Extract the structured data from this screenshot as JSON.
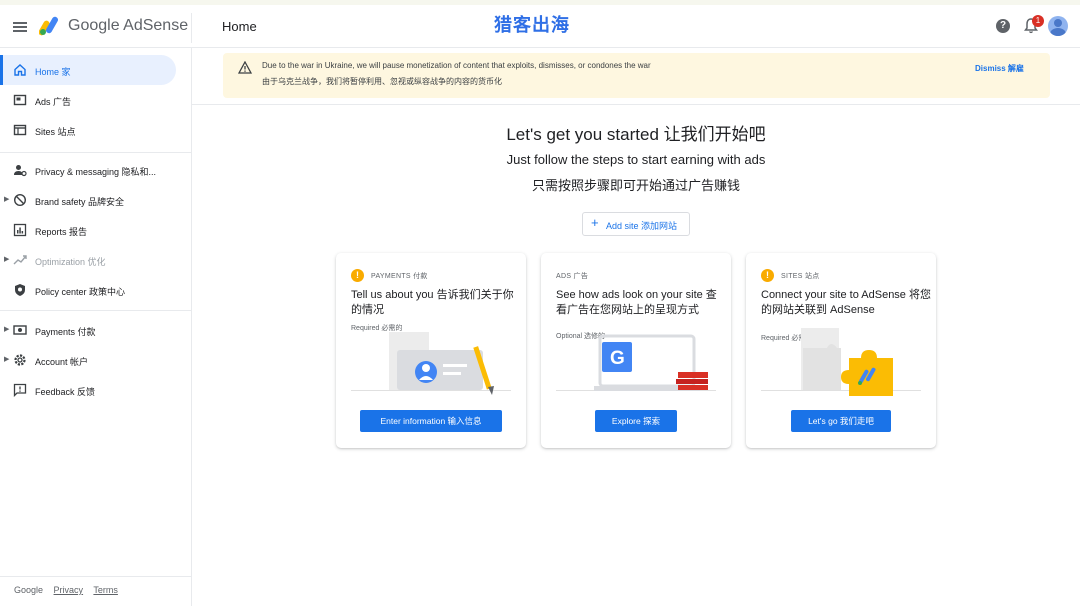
{
  "header": {
    "brand": "Google AdSense",
    "page_title": "Home",
    "watermark": "猎客出海",
    "help_glyph": "?",
    "notification_count": "1"
  },
  "sidebar": {
    "items": [
      {
        "label": "Home 家",
        "icon": "home-icon",
        "active": true
      },
      {
        "label": "Ads 广告",
        "icon": "ads-icon"
      },
      {
        "label": "Sites 站点",
        "icon": "sites-icon"
      },
      {
        "label": "Privacy & messaging 隐私和...",
        "icon": "privacy-icon"
      },
      {
        "label": "Brand safety 品牌安全",
        "icon": "block-icon"
      },
      {
        "label": "Reports 报告",
        "icon": "reports-icon"
      },
      {
        "label": "Optimization 优化",
        "icon": "trending-icon",
        "disabled": true
      },
      {
        "label": "Policy center 政策中心",
        "icon": "shield-icon"
      },
      {
        "label": "Payments 付款",
        "icon": "payments-icon"
      },
      {
        "label": "Account 帐户",
        "icon": "gear-icon"
      },
      {
        "label": "Feedback 反馈",
        "icon": "feedback-icon"
      }
    ],
    "footer": {
      "google": "Google",
      "privacy": "Privacy",
      "terms": "Terms"
    }
  },
  "banner": {
    "line1": "Due to the war in Ukraine, we will pause monetization of content that exploits, dismisses, or condones the war",
    "line2": "由于乌克兰战争，我们将暂停利用、忽视或纵容战争的内容的货币化",
    "dismiss": "Dismiss 解雇"
  },
  "hero": {
    "title": "Let's get you started  让我们开始吧",
    "subtitle_en": "Just follow the steps to start earning with ads",
    "subtitle_zh": "只需按照步骤即可开始通过广告赚钱",
    "add_site": "Add site  添加网站"
  },
  "cards": [
    {
      "kicker": "PAYMENTS  付款",
      "title": "Tell us about you  告诉我们关于你的情况",
      "requirement": "Required  必需的",
      "button": "Enter information  输入信息",
      "status_glyph": "!"
    },
    {
      "kicker": "ADS  广告",
      "title": "See how ads look on your site 查看广告在您网站上的呈现方式",
      "requirement": "Optional  选修的",
      "button": "Explore  探索"
    },
    {
      "kicker": "SITES  站点",
      "title": "Connect your site to AdSense 将您的网站关联到 AdSense",
      "requirement": "Required  必需的",
      "button": "Let's go  我们走吧",
      "status_glyph": "!"
    }
  ],
  "colors": {
    "accent": "#1a73e8",
    "warning": "#f9ab00",
    "banner": "#fef7e0",
    "badge": "#d93025"
  }
}
